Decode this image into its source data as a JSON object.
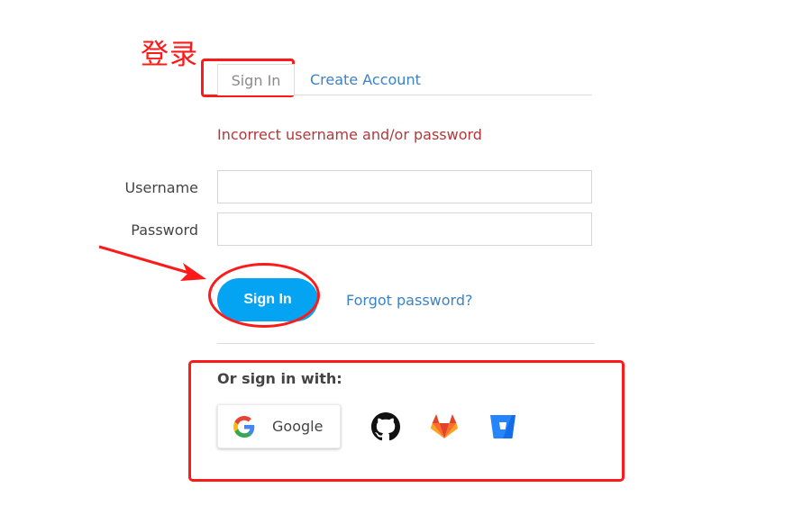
{
  "annotation": {
    "label": "登录",
    "color": "#ff1a1a"
  },
  "tabs": [
    {
      "label": "Sign In",
      "active": true
    },
    {
      "label": "Create Account",
      "active": false
    }
  ],
  "error_message": "Incorrect username and/or password",
  "form": {
    "username": {
      "label": "Username",
      "value": "",
      "placeholder": ""
    },
    "password": {
      "label": "Password",
      "value": "",
      "placeholder": ""
    },
    "submit_label": "Sign In",
    "forgot_label": "Forgot password?"
  },
  "social": {
    "heading": "Or sign in with:",
    "providers": [
      {
        "name": "Google",
        "icon": "google-icon"
      },
      {
        "name": "GitHub",
        "icon": "github-icon"
      },
      {
        "name": "GitLab",
        "icon": "gitlab-icon"
      },
      {
        "name": "Bitbucket",
        "icon": "bitbucket-icon"
      }
    ]
  },
  "colors": {
    "primary_button": "#04a4f2",
    "link": "#3c82c4",
    "error": "#b3383a"
  }
}
